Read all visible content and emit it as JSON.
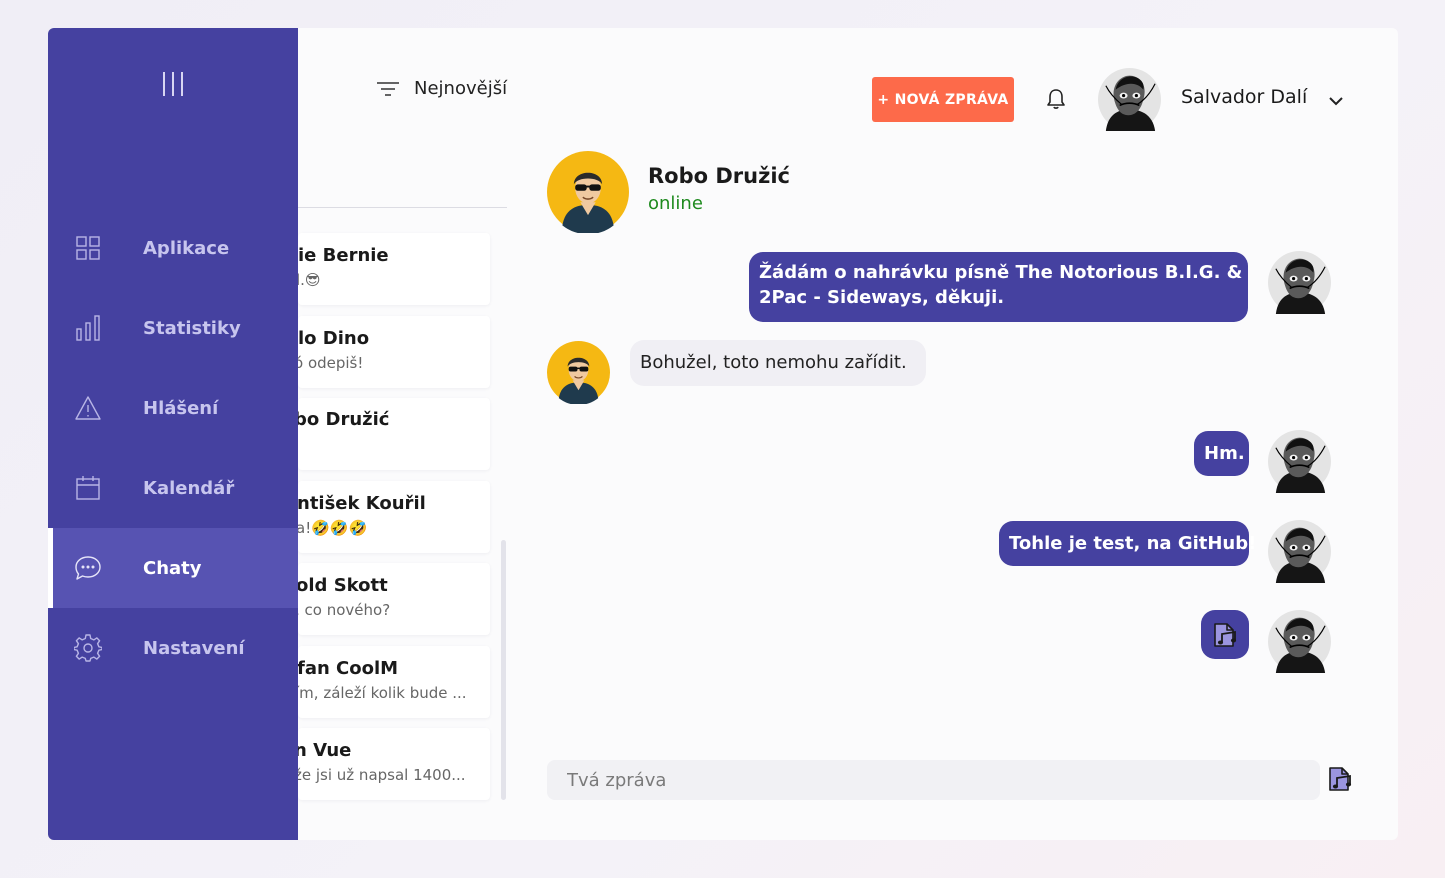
{
  "sidebar": {
    "items": [
      {
        "label": "Aplikace",
        "icon": "apps-grid-icon"
      },
      {
        "label": "Statistiky",
        "icon": "bar-chart-icon"
      },
      {
        "label": "Hlášení",
        "icon": "warning-triangle-icon"
      },
      {
        "label": "Kalendář",
        "icon": "calendar-icon"
      },
      {
        "label": "Chaty",
        "icon": "chat-bubble-icon",
        "active": true
      },
      {
        "label": "Nastavení",
        "icon": "gear-icon"
      }
    ]
  },
  "chatlist": {
    "sort_label": "Nejnovější",
    "chats": [
      {
        "name": "ie Bernie",
        "msg": "l.😎"
      },
      {
        "name": "lo Dino",
        "msg": "ó odepiš!"
      },
      {
        "name": "bo Družić",
        "msg": ""
      },
      {
        "name": "ntišek Kouřil",
        "msg": "a!🤣🤣🤣"
      },
      {
        "name": "old Skott",
        "msg": ", co nového?"
      },
      {
        "name": "fan CoolM",
        "msg": "ím, záleží kolik bude ..."
      },
      {
        "name": "n Vue",
        "msg": "že jsi už napsal 1400..."
      }
    ]
  },
  "header": {
    "new_message_label": "+ NOVÁ ZPRÁVA",
    "user_name": "Salvador Dalí"
  },
  "conversation": {
    "contact_name": "Robo Družić",
    "contact_status": "online",
    "messages": [
      {
        "direction": "out",
        "lines": [
          "Žádám o nahrávku písně The Notorious B.I.G. &",
          "2Pac - Sideways, děkuji."
        ]
      },
      {
        "direction": "in",
        "text": "Bohužel, toto nemohu zařídit."
      },
      {
        "direction": "out",
        "text": "Hm."
      },
      {
        "direction": "out",
        "text": "Tohle je test, na GitHub!"
      },
      {
        "direction": "out",
        "attachment": "music-file-icon"
      }
    ],
    "input_placeholder": "Tvá zpráva"
  },
  "colors": {
    "sidebar": "#4541a0",
    "sidebar_active": "#5753b2",
    "accent_button": "#fd6a4a",
    "bubble_out": "#4541a0",
    "bubble_in": "#f0eff4",
    "online": "#1e8a1e"
  }
}
